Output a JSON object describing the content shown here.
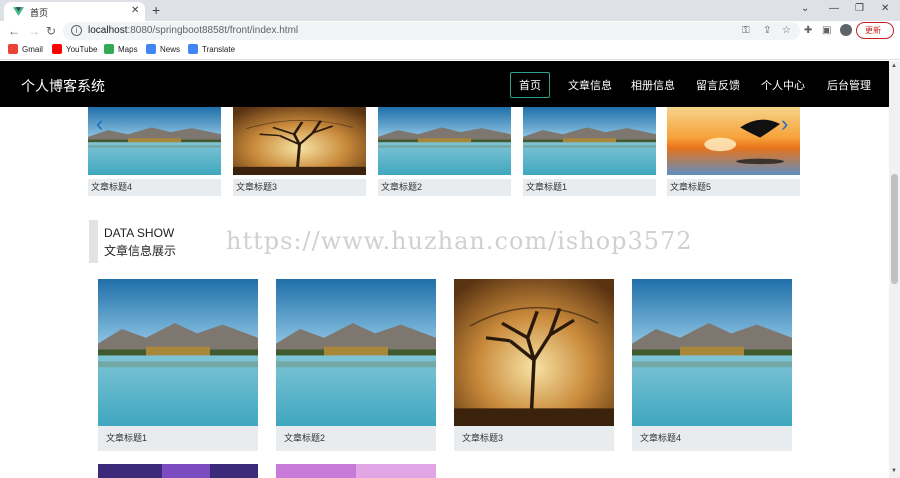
{
  "browser": {
    "tab_title": "首页",
    "url_host": "localhost",
    "url_path": ":8080/springboot8858t/front/index.html",
    "update_label": "更新",
    "bookmarks": [
      {
        "label": "Gmail",
        "icon": "gmail-icon",
        "color": "#ea4335"
      },
      {
        "label": "YouTube",
        "icon": "youtube-icon",
        "color": "#ff0000"
      },
      {
        "label": "Maps",
        "icon": "maps-icon",
        "color": "#34a853"
      },
      {
        "label": "News",
        "icon": "news-icon",
        "color": "#4285f4"
      },
      {
        "label": "Translate",
        "icon": "translate-icon",
        "color": "#4285f4"
      }
    ]
  },
  "site": {
    "title": "个人博客系统",
    "nav": [
      {
        "label": "首页",
        "active": true
      },
      {
        "label": "文章信息"
      },
      {
        "label": "相册信息"
      },
      {
        "label": "留言反馈"
      },
      {
        "label": "个人中心"
      },
      {
        "label": "后台管理"
      }
    ],
    "accent_color": "#2e9e8e"
  },
  "carousel": [
    {
      "caption": "文章标题4",
      "image": "lake"
    },
    {
      "caption": "文章标题3",
      "image": "tree"
    },
    {
      "caption": "文章标题2",
      "image": "lake"
    },
    {
      "caption": "文章标题1",
      "image": "lake"
    },
    {
      "caption": "文章标题5",
      "image": "sunset"
    }
  ],
  "section": {
    "title_en": "DATA SHOW",
    "title_zh": "文章信息展示"
  },
  "watermark": "https://www.huzhan.com/ishop3572",
  "articles": [
    {
      "caption": "文章标题1",
      "image": "lake"
    },
    {
      "caption": "文章标题2",
      "image": "lake"
    },
    {
      "caption": "文章标题3",
      "image": "tree"
    },
    {
      "caption": "文章标题4",
      "image": "lake"
    }
  ]
}
